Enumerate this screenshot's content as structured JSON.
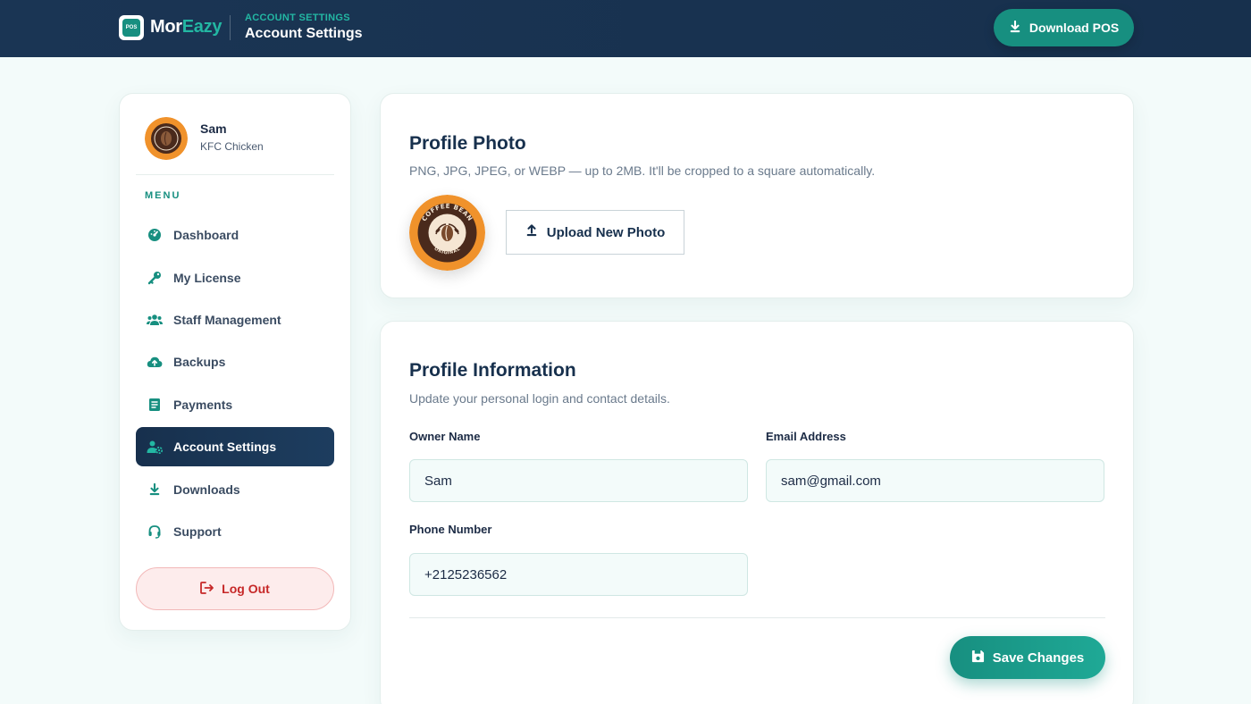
{
  "header": {
    "logo_icon_text": "POS",
    "brand_part1": "Mor",
    "brand_part2": "Eazy",
    "eyebrow": "ACCOUNT SETTINGS",
    "title": "Account Settings",
    "download_label": "Download POS"
  },
  "sidebar": {
    "user_name": "Sam",
    "company": "KFC Chicken",
    "menu_label": "MENU",
    "items": [
      {
        "label": "Dashboard",
        "icon": "dashboard-gauge-icon",
        "active": false
      },
      {
        "label": "My License",
        "icon": "key-icon",
        "active": false
      },
      {
        "label": "Staff Management",
        "icon": "users-icon",
        "active": false
      },
      {
        "label": "Backups",
        "icon": "cloud-upload-icon",
        "active": false
      },
      {
        "label": "Payments",
        "icon": "receipt-icon",
        "active": false
      },
      {
        "label": "Account Settings",
        "icon": "user-gear-icon",
        "active": true
      },
      {
        "label": "Downloads",
        "icon": "download-icon",
        "active": false
      },
      {
        "label": "Support",
        "icon": "headset-icon",
        "active": false
      }
    ],
    "logout_label": "Log Out"
  },
  "photo_card": {
    "title": "Profile Photo",
    "subtitle": "PNG, JPG, JPEG, or WEBP — up to 2MB. It'll be cropped to a square automatically.",
    "avatar_text_top": "COFFEE BEAN",
    "avatar_text_bottom": "ORIGINAL",
    "upload_label": "Upload New Photo"
  },
  "info_card": {
    "title": "Profile Information",
    "subtitle": "Update your personal login and contact details.",
    "owner_label": "Owner Name",
    "owner_value": "Sam",
    "email_label": "Email Address",
    "email_value": "sam@gmail.com",
    "phone_label": "Phone Number",
    "phone_value": "+2125236562",
    "save_label": "Save Changes"
  },
  "colors": {
    "primary": "#178f80",
    "navy": "#17304d",
    "accent": "#23b7a3",
    "danger": "#c62828",
    "avatar_orange": "#f0922b"
  }
}
